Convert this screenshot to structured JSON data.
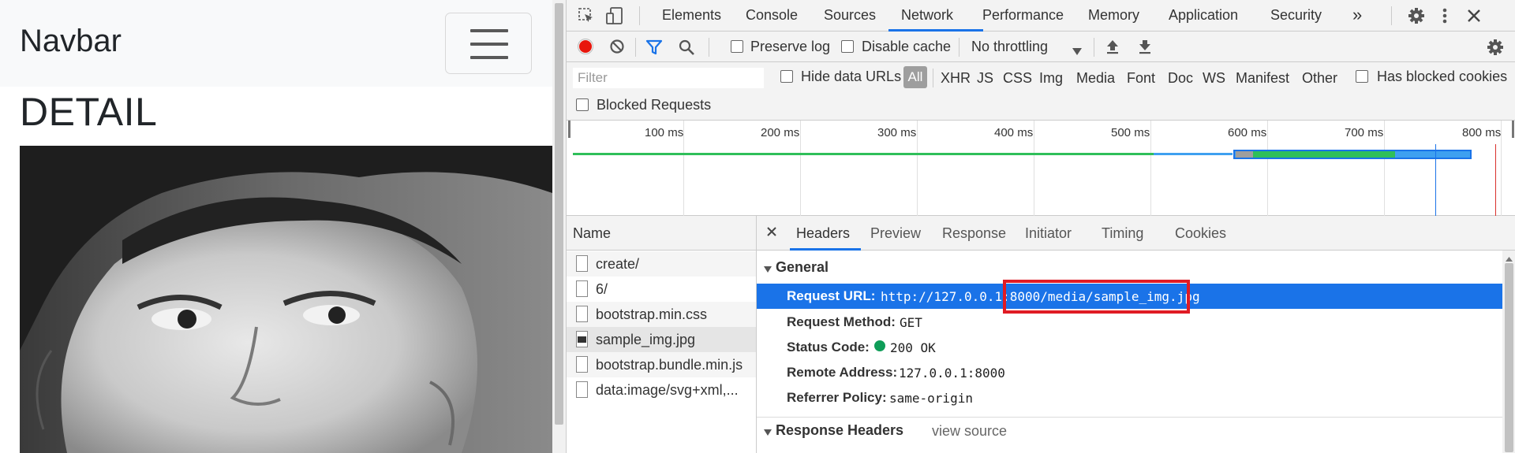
{
  "page": {
    "brand": "Navbar",
    "heading": "DETAIL"
  },
  "devtools": {
    "tabs": [
      "Elements",
      "Console",
      "Sources",
      "Network",
      "Performance",
      "Memory",
      "Application",
      "Security"
    ],
    "selected_tab": "Network",
    "more_tabs": "»",
    "toolbar": {
      "preserve_log": "Preserve log",
      "disable_cache": "Disable cache",
      "throttling": "No throttling"
    },
    "filter": {
      "placeholder": "Filter",
      "hide_data_urls": "Hide data URLs",
      "all": "All",
      "types": [
        "XHR",
        "JS",
        "CSS",
        "Img",
        "Media",
        "Font",
        "Doc",
        "WS",
        "Manifest",
        "Other"
      ],
      "has_blocked_cookies": "Has blocked cookies",
      "blocked_requests": "Blocked Requests"
    },
    "timeline_ticks": [
      "100 ms",
      "200 ms",
      "300 ms",
      "400 ms",
      "500 ms",
      "600 ms",
      "700 ms",
      "800 ms"
    ],
    "request_list": {
      "header": "Name",
      "items": [
        "create/",
        "6/",
        "bootstrap.min.css",
        "sample_img.jpg",
        "bootstrap.bundle.min.js",
        "data:image/svg+xml,..."
      ],
      "selected": "sample_img.jpg"
    },
    "details": {
      "tabs": [
        "Headers",
        "Preview",
        "Response",
        "Initiator",
        "Timing",
        "Cookies"
      ],
      "selected_tab": "Headers",
      "general_title": "General",
      "request_url_label": "Request URL:",
      "request_url": "http://127.0.0.1:8000/media/sample_img.jpg",
      "request_method_label": "Request Method:",
      "request_method": "GET",
      "status_code_label": "Status Code:",
      "status_code": "200 OK",
      "remote_address_label": "Remote Address:",
      "remote_address": "127.0.0.1:8000",
      "referrer_policy_label": "Referrer Policy:",
      "referrer_policy": "same-origin",
      "response_headers_title": "Response Headers",
      "view_source": "view source"
    },
    "colors": {
      "accent": "#1a73e8",
      "record": "#e8160c",
      "highlight_box": "#e01b24",
      "status_ok": "#0f9d58"
    }
  }
}
